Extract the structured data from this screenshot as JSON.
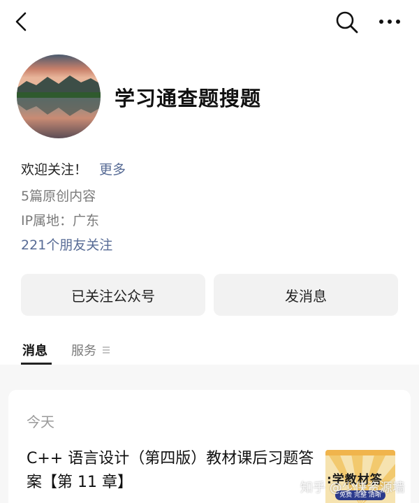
{
  "account": {
    "name": "学习通查题搜题",
    "welcome": "欢迎关注！",
    "more_label": "更多",
    "original_count_text": "5篇原创内容",
    "ip_location": "IP属地：广东",
    "friends_following": "221个朋友关注"
  },
  "actions": {
    "followed_label": "已关注公众号",
    "message_label": "发消息"
  },
  "tabs": [
    {
      "label": "消息",
      "active": true
    },
    {
      "label": "服务",
      "active": false
    }
  ],
  "feed": {
    "date_label": "今天",
    "articles": [
      {
        "title": "C++ 语言设计（第四版）教材课后习题答案【第 11 章】",
        "thumbnail_text": ":学教材答",
        "thumbnail_sub": "免费 完整 清晰"
      }
    ]
  },
  "watermark": "知乎 @少侠资源墙",
  "icons": {
    "back": "chevron-left-icon",
    "search": "search-icon",
    "more": "more-dots-icon",
    "service": "menu-lines-icon"
  },
  "colors": {
    "link": "#576b95",
    "page_bg": "#f7f7f7",
    "button_bg": "#f2f2f2"
  }
}
